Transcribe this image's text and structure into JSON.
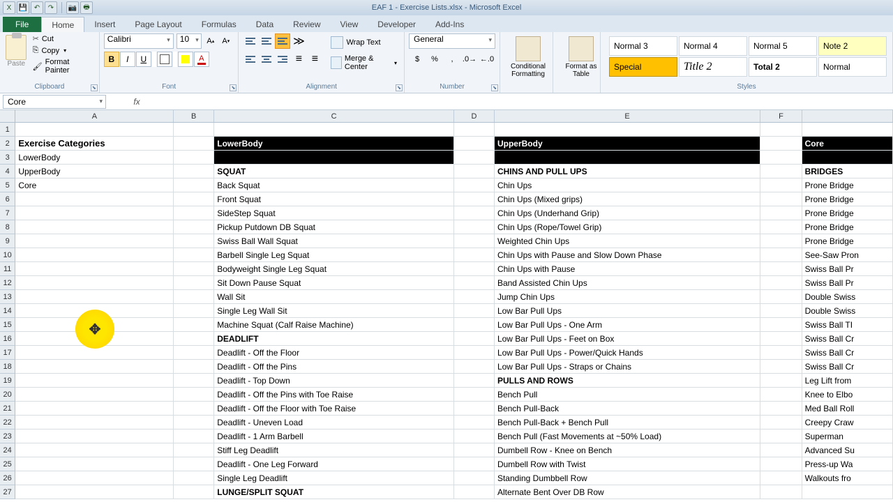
{
  "title": "EAF 1 - Exercise Lists.xlsx - Microsoft Excel",
  "tabs": {
    "file": "File",
    "home": "Home",
    "insert": "Insert",
    "pagelayout": "Page Layout",
    "formulas": "Formulas",
    "data": "Data",
    "review": "Review",
    "view": "View",
    "developer": "Developer",
    "addins": "Add-Ins"
  },
  "clipboard": {
    "label": "Clipboard",
    "paste": "Paste",
    "cut": "Cut",
    "copy": "Copy",
    "format_painter": "Format Painter"
  },
  "font": {
    "label": "Font",
    "name": "Calibri",
    "size": "10"
  },
  "alignment": {
    "label": "Alignment",
    "wrap": "Wrap Text",
    "merge": "Merge & Center"
  },
  "number": {
    "label": "Number",
    "format": "General"
  },
  "cond_fmt": "Conditional Formatting",
  "fmt_table": "Format as Table",
  "styles": {
    "label": "Styles",
    "normal3": "Normal 3",
    "normal4": "Normal 4",
    "normal5": "Normal 5",
    "note2": "Note 2",
    "special": "Special",
    "title2": "Title 2",
    "total2": "Total 2",
    "normal": "Normal"
  },
  "name_box": "Core",
  "formula": "",
  "columns": [
    "A",
    "B",
    "C",
    "D",
    "E",
    "F"
  ],
  "rows": {
    "2": {
      "A": "Exercise Categories",
      "C": "LowerBody",
      "E": "UpperBody",
      "G": "Core"
    },
    "3": {
      "A": "LowerBody",
      "C": "",
      "E": "",
      "G": ""
    },
    "4": {
      "A": "UpperBody",
      "C": "SQUAT",
      "E": "CHINS AND PULL UPS",
      "G": "BRIDGES"
    },
    "5": {
      "A": "Core",
      "C": "Back Squat",
      "E": "Chin Ups",
      "G": "Prone Bridge"
    },
    "6": {
      "C": "Front Squat",
      "E": "Chin Ups (Mixed grips)",
      "G": "Prone Bridge"
    },
    "7": {
      "C": "SideStep Squat",
      "E": "Chin Ups (Underhand Grip)",
      "G": "Prone Bridge"
    },
    "8": {
      "C": "Pickup Putdown DB Squat",
      "E": "Chin Ups (Rope/Towel Grip)",
      "G": "Prone Bridge"
    },
    "9": {
      "C": "Swiss Ball Wall Squat",
      "E": "Weighted Chin Ups",
      "G": "Prone Bridge"
    },
    "10": {
      "C": "Barbell Single Leg Squat",
      "E": "Chin Ups with Pause and Slow Down Phase",
      "G": "See-Saw Pron"
    },
    "11": {
      "C": "Bodyweight Single Leg Squat",
      "E": "Chin Ups with Pause",
      "G": "Swiss Ball Pr"
    },
    "12": {
      "C": "Sit Down Pause Squat",
      "E": "Band Assisted Chin Ups",
      "G": "Swiss Ball Pr"
    },
    "13": {
      "C": "Wall Sit",
      "E": "Jump Chin Ups",
      "G": "Double Swiss"
    },
    "14": {
      "C": "Single Leg Wall Sit",
      "E": "Low Bar Pull Ups",
      "G": "Double Swiss"
    },
    "15": {
      "C": "Machine Squat (Calf Raise Machine)",
      "E": "Low Bar Pull Ups - One Arm",
      "G": "Swiss Ball TI"
    },
    "16": {
      "C": "DEADLIFT",
      "E": "Low Bar Pull Ups - Feet on Box",
      "G": "Swiss Ball Cr"
    },
    "17": {
      "C": "Deadlift - Off the Floor",
      "E": "Low Bar Pull Ups - Power/Quick Hands",
      "G": "Swiss Ball Cr"
    },
    "18": {
      "C": "Deadlift - Off the Pins",
      "E": "Low Bar Pull Ups - Straps or Chains",
      "G": "Swiss Ball Cr"
    },
    "19": {
      "C": "Deadlift - Top Down",
      "E": "PULLS AND ROWS",
      "G": "Leg Lift from"
    },
    "20": {
      "C": "Deadlift - Off the Pins with Toe Raise",
      "E": "Bench Pull",
      "G": "Knee to Elbo"
    },
    "21": {
      "C": "Deadlift - Off the Floor with Toe Raise",
      "E": "Bench Pull-Back",
      "G": "Med Ball Roll"
    },
    "22": {
      "C": "Deadlift - Uneven Load",
      "E": "Bench Pull-Back + Bench Pull",
      "G": "Creepy Craw"
    },
    "23": {
      "C": "Deadlift - 1 Arm Barbell",
      "E": "Bench Pull (Fast Movements at ~50% Load)",
      "G": "Superman"
    },
    "24": {
      "C": "Stiff Leg Deadlift",
      "E": "Dumbell Row - Knee on Bench",
      "G": "Advanced Su"
    },
    "25": {
      "C": "Deadlift - One Leg Forward",
      "E": "Dumbell Row with Twist",
      "G": "Press-up Wa"
    },
    "26": {
      "C": "Single Leg Deadlift",
      "E": "Standing Dumbbell Row",
      "G": "Walkouts fro"
    },
    "27": {
      "C": "LUNGE/SPLIT SQUAT",
      "E": "Alternate Bent Over DB Row",
      "G": ""
    }
  },
  "bold_cells": {
    "4C": true,
    "4E": true,
    "4G": true,
    "16C": true,
    "19E": true,
    "27C": true
  }
}
